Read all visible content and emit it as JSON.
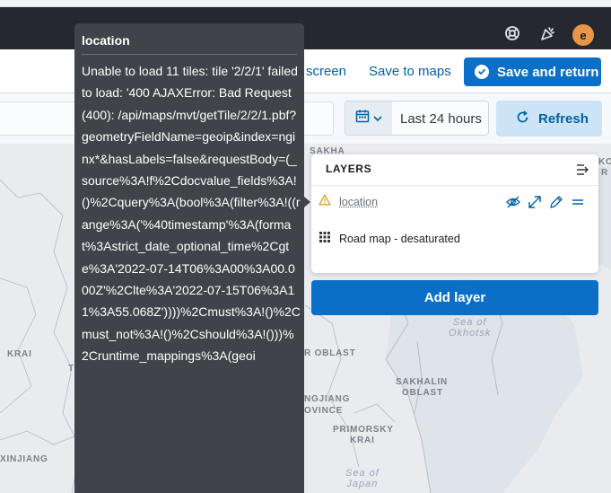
{
  "header": {
    "avatar_initial": "e",
    "help_icon": "lifebuoy-icon",
    "news_icon": "party-popper-icon"
  },
  "toolbar": {
    "fullscreen_label": "screen",
    "save_to_maps_label": "Save to maps",
    "save_and_return_label": "Save and return"
  },
  "querybar": {
    "search_value": "",
    "date_range": "Last 24 hours",
    "refresh_label": "Refresh"
  },
  "layers": {
    "title": "LAYERS",
    "items": [
      {
        "name": "location",
        "status": "warning",
        "icon": "warning-icon"
      },
      {
        "name": "Road map - desaturated",
        "status": "ok",
        "icon": "grid-icon"
      }
    ],
    "add_layer_label": "Add layer"
  },
  "map": {
    "labels": [
      "SAKHA",
      "KO",
      "R",
      "KRAI",
      "T",
      "R OBLAST",
      "NGJIANG",
      "OVINCE",
      "SAKHALIN",
      "OBLAST",
      "PRIMORSKY",
      "KRAI",
      "XINJIANG"
    ],
    "seas": [
      {
        "line1": "Sea of",
        "line2": "Okhotsk"
      },
      {
        "line1": "Sea of",
        "line2": "Japan"
      }
    ]
  },
  "tooltip": {
    "title": "location",
    "message": "Unable to load 11 tiles: tile '2/2/1' failed to load: '400 AJAXError: Bad Request (400): /api/maps/mvt/getTile/2/2/1.pbf?geometryFieldName=geoip&index=nginx*&hasLabels=false&requestBody=(_source%3A!f%2Cdocvalue_fields%3A!()%2Cquery%3A(bool%3A(filter%3A!((range%3A('%40timestamp'%3A(format%3Astrict_date_optional_time%2Cgte%3A'2022-07-14T06%3A00%3A00.000Z'%2Clte%3A'2022-07-15T06%3A11%3A55.068Z'))))%2Cmust%3A!()%2Cmust_not%3A!()%2Cshould%3A!()))%2Cruntime_mappings%3A(geoi"
  },
  "colors": {
    "header_bg": "#25282f",
    "primary": "#0b6fc8",
    "link": "#0061a6",
    "tooltip_bg": "#404349",
    "warning": "#d4a017",
    "map_bg": "#e8eaee"
  }
}
